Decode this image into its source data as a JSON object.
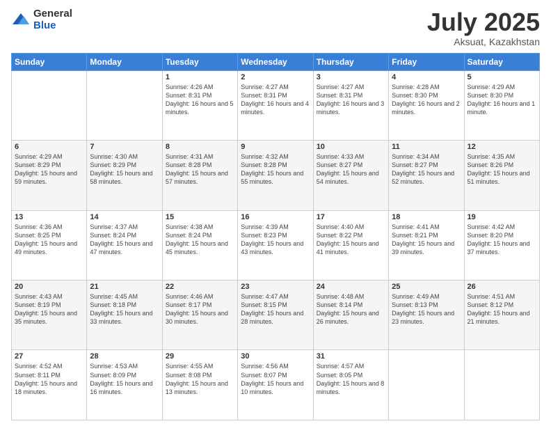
{
  "logo": {
    "general": "General",
    "blue": "Blue"
  },
  "title": "July 2025",
  "subtitle": "Aksuat, Kazakhstan",
  "weekdays": [
    "Sunday",
    "Monday",
    "Tuesday",
    "Wednesday",
    "Thursday",
    "Friday",
    "Saturday"
  ],
  "weeks": [
    [
      null,
      null,
      {
        "day": 1,
        "sunrise": "4:26 AM",
        "sunset": "8:31 PM",
        "daylight": "16 hours and 5 minutes."
      },
      {
        "day": 2,
        "sunrise": "4:27 AM",
        "sunset": "8:31 PM",
        "daylight": "16 hours and 4 minutes."
      },
      {
        "day": 3,
        "sunrise": "4:27 AM",
        "sunset": "8:31 PM",
        "daylight": "16 hours and 3 minutes."
      },
      {
        "day": 4,
        "sunrise": "4:28 AM",
        "sunset": "8:30 PM",
        "daylight": "16 hours and 2 minutes."
      },
      {
        "day": 5,
        "sunrise": "4:29 AM",
        "sunset": "8:30 PM",
        "daylight": "16 hours and 1 minute."
      }
    ],
    [
      {
        "day": 6,
        "sunrise": "4:29 AM",
        "sunset": "8:29 PM",
        "daylight": "15 hours and 59 minutes."
      },
      {
        "day": 7,
        "sunrise": "4:30 AM",
        "sunset": "8:29 PM",
        "daylight": "15 hours and 58 minutes."
      },
      {
        "day": 8,
        "sunrise": "4:31 AM",
        "sunset": "8:28 PM",
        "daylight": "15 hours and 57 minutes."
      },
      {
        "day": 9,
        "sunrise": "4:32 AM",
        "sunset": "8:28 PM",
        "daylight": "15 hours and 55 minutes."
      },
      {
        "day": 10,
        "sunrise": "4:33 AM",
        "sunset": "8:27 PM",
        "daylight": "15 hours and 54 minutes."
      },
      {
        "day": 11,
        "sunrise": "4:34 AM",
        "sunset": "8:27 PM",
        "daylight": "15 hours and 52 minutes."
      },
      {
        "day": 12,
        "sunrise": "4:35 AM",
        "sunset": "8:26 PM",
        "daylight": "15 hours and 51 minutes."
      }
    ],
    [
      {
        "day": 13,
        "sunrise": "4:36 AM",
        "sunset": "8:25 PM",
        "daylight": "15 hours and 49 minutes."
      },
      {
        "day": 14,
        "sunrise": "4:37 AM",
        "sunset": "8:24 PM",
        "daylight": "15 hours and 47 minutes."
      },
      {
        "day": 15,
        "sunrise": "4:38 AM",
        "sunset": "8:24 PM",
        "daylight": "15 hours and 45 minutes."
      },
      {
        "day": 16,
        "sunrise": "4:39 AM",
        "sunset": "8:23 PM",
        "daylight": "15 hours and 43 minutes."
      },
      {
        "day": 17,
        "sunrise": "4:40 AM",
        "sunset": "8:22 PM",
        "daylight": "15 hours and 41 minutes."
      },
      {
        "day": 18,
        "sunrise": "4:41 AM",
        "sunset": "8:21 PM",
        "daylight": "15 hours and 39 minutes."
      },
      {
        "day": 19,
        "sunrise": "4:42 AM",
        "sunset": "8:20 PM",
        "daylight": "15 hours and 37 minutes."
      }
    ],
    [
      {
        "day": 20,
        "sunrise": "4:43 AM",
        "sunset": "8:19 PM",
        "daylight": "15 hours and 35 minutes."
      },
      {
        "day": 21,
        "sunrise": "4:45 AM",
        "sunset": "8:18 PM",
        "daylight": "15 hours and 33 minutes."
      },
      {
        "day": 22,
        "sunrise": "4:46 AM",
        "sunset": "8:17 PM",
        "daylight": "15 hours and 30 minutes."
      },
      {
        "day": 23,
        "sunrise": "4:47 AM",
        "sunset": "8:15 PM",
        "daylight": "15 hours and 28 minutes."
      },
      {
        "day": 24,
        "sunrise": "4:48 AM",
        "sunset": "8:14 PM",
        "daylight": "15 hours and 26 minutes."
      },
      {
        "day": 25,
        "sunrise": "4:49 AM",
        "sunset": "8:13 PM",
        "daylight": "15 hours and 23 minutes."
      },
      {
        "day": 26,
        "sunrise": "4:51 AM",
        "sunset": "8:12 PM",
        "daylight": "15 hours and 21 minutes."
      }
    ],
    [
      {
        "day": 27,
        "sunrise": "4:52 AM",
        "sunset": "8:11 PM",
        "daylight": "15 hours and 18 minutes."
      },
      {
        "day": 28,
        "sunrise": "4:53 AM",
        "sunset": "8:09 PM",
        "daylight": "15 hours and 16 minutes."
      },
      {
        "day": 29,
        "sunrise": "4:55 AM",
        "sunset": "8:08 PM",
        "daylight": "15 hours and 13 minutes."
      },
      {
        "day": 30,
        "sunrise": "4:56 AM",
        "sunset": "8:07 PM",
        "daylight": "15 hours and 10 minutes."
      },
      {
        "day": 31,
        "sunrise": "4:57 AM",
        "sunset": "8:05 PM",
        "daylight": "15 hours and 8 minutes."
      },
      null,
      null
    ]
  ]
}
